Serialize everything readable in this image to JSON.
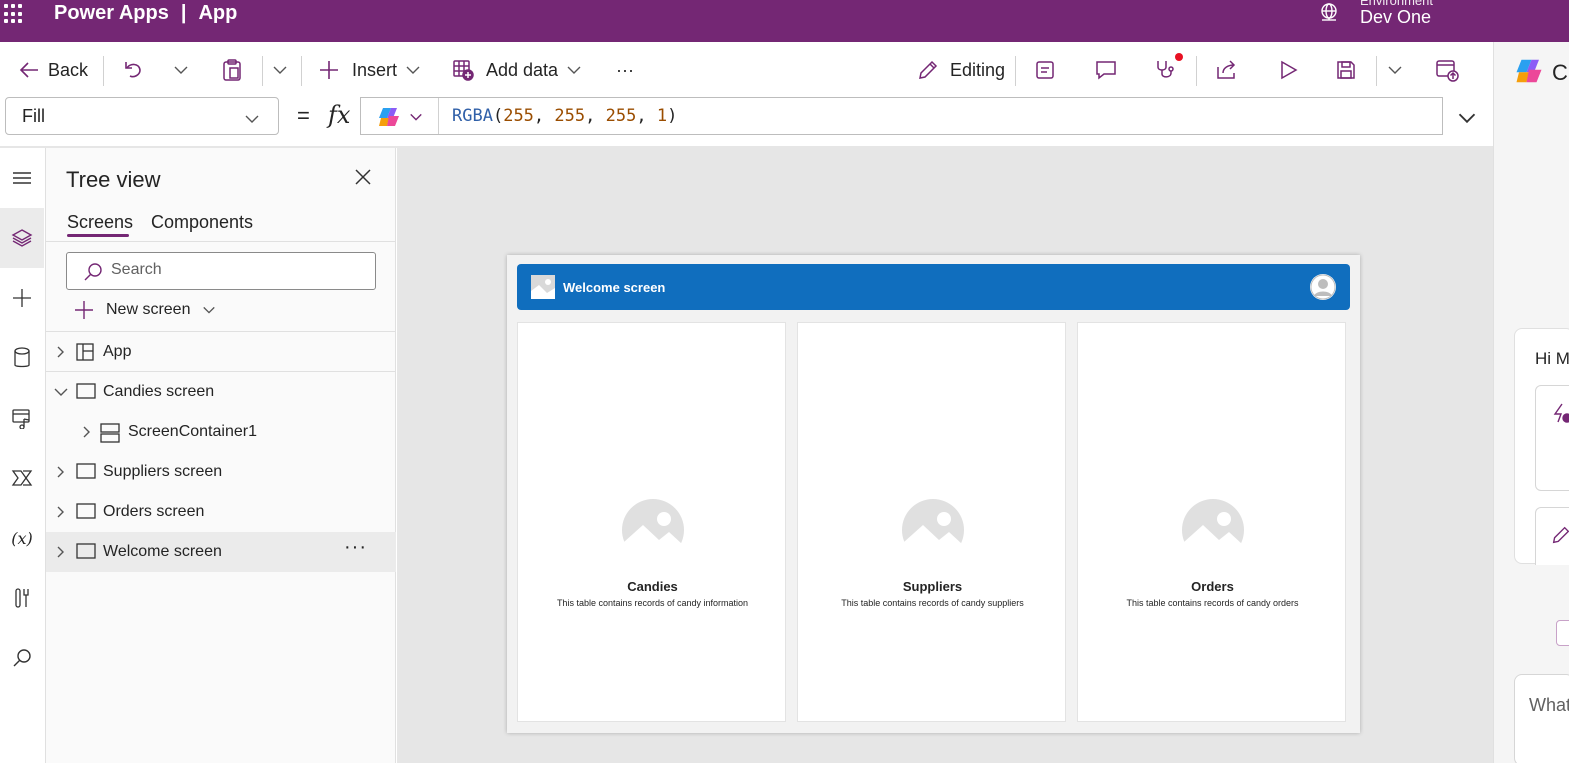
{
  "topbar": {
    "product": "Power Apps",
    "divider": "|",
    "app_label": "App",
    "environment_label": "Environment",
    "environment_name": "Dev One"
  },
  "commandbar": {
    "back_label": "Back",
    "insert_label": "Insert",
    "add_data_label": "Add data",
    "more_label": "···",
    "editing_label": "Editing"
  },
  "formula": {
    "property": "Fill",
    "equals": "=",
    "fx": "fx",
    "fn_name": "RGBA",
    "args": [
      "255",
      "255",
      "255",
      "1"
    ]
  },
  "tree": {
    "title": "Tree view",
    "tabs": [
      "Screens",
      "Components"
    ],
    "search_placeholder": "Search",
    "new_screen_label": "New screen",
    "items": [
      {
        "label": "App"
      },
      {
        "label": "Candies screen"
      },
      {
        "label": "ScreenContainer1"
      },
      {
        "label": "Suppliers screen"
      },
      {
        "label": "Orders screen"
      },
      {
        "label": "Welcome screen"
      }
    ],
    "row_more": "···"
  },
  "canvas": {
    "header_title": "Welcome screen",
    "cards": [
      {
        "title": "Candies",
        "description": "This table contains records of candy information"
      },
      {
        "title": "Suppliers",
        "description": "This table contains records of candy suppliers"
      },
      {
        "title": "Orders",
        "description": "This table contains records of candy orders"
      }
    ]
  },
  "copilot": {
    "name": "C",
    "greeting": "Hi M",
    "input_placeholder": "What"
  },
  "colors": {
    "brand_purple": "#742774",
    "header_blue": "#106ebe",
    "notification_red": "#e81123",
    "canvas_bg": "#e6e6e6"
  }
}
